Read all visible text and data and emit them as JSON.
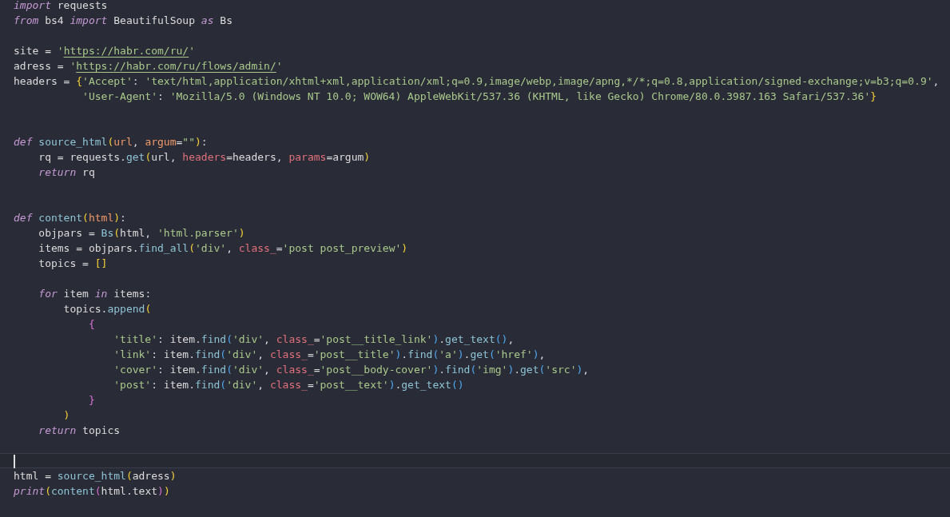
{
  "editor": {
    "lines": [
      {
        "current": false,
        "tokens": [
          {
            "kind": "keyword",
            "text": "import"
          },
          {
            "kind": "plain",
            "text": " requests"
          }
        ]
      },
      {
        "current": false,
        "tokens": [
          {
            "kind": "keyword",
            "text": "from"
          },
          {
            "kind": "plain",
            "text": " bs4 "
          },
          {
            "kind": "keyword",
            "text": "import"
          },
          {
            "kind": "plain",
            "text": " BeautifulSoup "
          },
          {
            "kind": "keyword",
            "text": "as"
          },
          {
            "kind": "plain",
            "text": " Bs"
          }
        ]
      },
      {
        "current": false
      },
      {
        "current": false,
        "tokens": [
          {
            "kind": "plain",
            "text": "site = "
          },
          {
            "kind": "string",
            "text": "'"
          },
          {
            "kind": "link",
            "text": "https://habr.com/ru/"
          },
          {
            "kind": "string",
            "text": "'"
          }
        ]
      },
      {
        "current": false,
        "tokens": [
          {
            "kind": "plain",
            "text": "adress = "
          },
          {
            "kind": "string",
            "text": "'"
          },
          {
            "kind": "link",
            "text": "https://habr.com/ru/flows/admin/"
          },
          {
            "kind": "string",
            "text": "'"
          }
        ]
      },
      {
        "current": false,
        "tokens": [
          {
            "kind": "plain",
            "text": "headers = "
          },
          {
            "kind": "bracket1",
            "text": "{"
          },
          {
            "kind": "string",
            "text": "'Accept'"
          },
          {
            "kind": "plain",
            "text": ": "
          },
          {
            "kind": "string",
            "text": "'text/html,application/xhtml+xml,application/xml;q=0.9,image/webp,image/apng,*/*;q=0.8,application/signed-exchange;v=b3;q=0.9'"
          },
          {
            "kind": "plain",
            "text": ","
          }
        ]
      },
      {
        "current": false,
        "tokens": [
          {
            "kind": "string",
            "text": "           'User-Agent'"
          },
          {
            "kind": "plain",
            "text": ": "
          },
          {
            "kind": "string",
            "text": "'Mozilla/5.0 (Windows NT 10.0; WOW64) AppleWebKit/537.36 (KHTML, like Gecko) Chrome/80.0.3987.163 Safari/537.36'"
          },
          {
            "kind": "bracket1",
            "text": "}"
          }
        ]
      },
      {
        "current": false
      },
      {
        "current": false
      },
      {
        "current": false,
        "tokens": [
          {
            "kind": "keyword",
            "text": "def "
          },
          {
            "kind": "function",
            "text": "source_html"
          },
          {
            "kind": "bracket1",
            "text": "("
          },
          {
            "kind": "param",
            "text": "url"
          },
          {
            "kind": "plain",
            "text": ", "
          },
          {
            "kind": "param",
            "text": "argum"
          },
          {
            "kind": "plain",
            "text": "="
          },
          {
            "kind": "string",
            "text": "\"\""
          },
          {
            "kind": "bracket1",
            "text": ")"
          },
          {
            "kind": "plain",
            "text": ":"
          }
        ]
      },
      {
        "current": false,
        "tokens": [
          {
            "kind": "plain",
            "text": "    rq = requests."
          },
          {
            "kind": "function",
            "text": "get"
          },
          {
            "kind": "bracket1",
            "text": "("
          },
          {
            "kind": "plain",
            "text": "url, "
          },
          {
            "kind": "kwarg",
            "text": "headers"
          },
          {
            "kind": "plain",
            "text": "=headers, "
          },
          {
            "kind": "kwarg",
            "text": "params"
          },
          {
            "kind": "plain",
            "text": "=argum"
          },
          {
            "kind": "bracket1",
            "text": ")"
          }
        ]
      },
      {
        "current": false,
        "tokens": [
          {
            "kind": "keyword",
            "text": "    return"
          },
          {
            "kind": "plain",
            "text": " rq"
          }
        ]
      },
      {
        "current": false
      },
      {
        "current": false
      },
      {
        "current": false,
        "tokens": [
          {
            "kind": "keyword",
            "text": "def "
          },
          {
            "kind": "function",
            "text": "content"
          },
          {
            "kind": "bracket1",
            "text": "("
          },
          {
            "kind": "param",
            "text": "html"
          },
          {
            "kind": "bracket1",
            "text": ")"
          },
          {
            "kind": "plain",
            "text": ":"
          }
        ]
      },
      {
        "current": false,
        "tokens": [
          {
            "kind": "plain",
            "text": "    objpars = "
          },
          {
            "kind": "function",
            "text": "Bs"
          },
          {
            "kind": "bracket1",
            "text": "("
          },
          {
            "kind": "plain",
            "text": "html, "
          },
          {
            "kind": "string",
            "text": "'html.parser'"
          },
          {
            "kind": "bracket1",
            "text": ")"
          }
        ]
      },
      {
        "current": false,
        "tokens": [
          {
            "kind": "plain",
            "text": "    items = objpars."
          },
          {
            "kind": "function",
            "text": "find_all"
          },
          {
            "kind": "bracket1",
            "text": "("
          },
          {
            "kind": "string",
            "text": "'div'"
          },
          {
            "kind": "plain",
            "text": ", "
          },
          {
            "kind": "kwarg",
            "text": "class_"
          },
          {
            "kind": "plain",
            "text": "="
          },
          {
            "kind": "string",
            "text": "'post post_preview'"
          },
          {
            "kind": "bracket1",
            "text": ")"
          }
        ]
      },
      {
        "current": false,
        "tokens": [
          {
            "kind": "plain",
            "text": "    topics = "
          },
          {
            "kind": "bracket1",
            "text": "[]"
          }
        ]
      },
      {
        "current": false
      },
      {
        "current": false,
        "tokens": [
          {
            "kind": "keyword",
            "text": "    for"
          },
          {
            "kind": "plain",
            "text": " item "
          },
          {
            "kind": "keyword",
            "text": "in"
          },
          {
            "kind": "plain",
            "text": " items:"
          }
        ]
      },
      {
        "current": false,
        "tokens": [
          {
            "kind": "plain",
            "text": "        topics."
          },
          {
            "kind": "function",
            "text": "append"
          },
          {
            "kind": "bracket1",
            "text": "("
          }
        ]
      },
      {
        "current": false,
        "tokens": [
          {
            "kind": "bracket2",
            "text": "            {"
          }
        ]
      },
      {
        "current": false,
        "tokens": [
          {
            "kind": "string",
            "text": "                'title'"
          },
          {
            "kind": "plain",
            "text": ": item."
          },
          {
            "kind": "function",
            "text": "find"
          },
          {
            "kind": "bracket3",
            "text": "("
          },
          {
            "kind": "string",
            "text": "'div'"
          },
          {
            "kind": "plain",
            "text": ", "
          },
          {
            "kind": "kwarg",
            "text": "class_"
          },
          {
            "kind": "plain",
            "text": "="
          },
          {
            "kind": "string",
            "text": "'post__title_link'"
          },
          {
            "kind": "bracket3",
            "text": ")"
          },
          {
            "kind": "plain",
            "text": "."
          },
          {
            "kind": "function",
            "text": "get_text"
          },
          {
            "kind": "bracket3",
            "text": "()"
          },
          {
            "kind": "plain",
            "text": ","
          }
        ]
      },
      {
        "current": false,
        "tokens": [
          {
            "kind": "string",
            "text": "                'link'"
          },
          {
            "kind": "plain",
            "text": ": item."
          },
          {
            "kind": "function",
            "text": "find"
          },
          {
            "kind": "bracket3",
            "text": "("
          },
          {
            "kind": "string",
            "text": "'div'"
          },
          {
            "kind": "plain",
            "text": ", "
          },
          {
            "kind": "kwarg",
            "text": "class_"
          },
          {
            "kind": "plain",
            "text": "="
          },
          {
            "kind": "string",
            "text": "'post__title'"
          },
          {
            "kind": "bracket3",
            "text": ")"
          },
          {
            "kind": "plain",
            "text": "."
          },
          {
            "kind": "function",
            "text": "find"
          },
          {
            "kind": "bracket3",
            "text": "("
          },
          {
            "kind": "string",
            "text": "'a'"
          },
          {
            "kind": "bracket3",
            "text": ")"
          },
          {
            "kind": "plain",
            "text": "."
          },
          {
            "kind": "function",
            "text": "get"
          },
          {
            "kind": "bracket3",
            "text": "("
          },
          {
            "kind": "string",
            "text": "'href'"
          },
          {
            "kind": "bracket3",
            "text": ")"
          },
          {
            "kind": "plain",
            "text": ","
          }
        ]
      },
      {
        "current": false,
        "tokens": [
          {
            "kind": "string",
            "text": "                'cover'"
          },
          {
            "kind": "plain",
            "text": ": item."
          },
          {
            "kind": "function",
            "text": "find"
          },
          {
            "kind": "bracket3",
            "text": "("
          },
          {
            "kind": "string",
            "text": "'div'"
          },
          {
            "kind": "plain",
            "text": ", "
          },
          {
            "kind": "kwarg",
            "text": "class_"
          },
          {
            "kind": "plain",
            "text": "="
          },
          {
            "kind": "string",
            "text": "'post__body-cover'"
          },
          {
            "kind": "bracket3",
            "text": ")"
          },
          {
            "kind": "plain",
            "text": "."
          },
          {
            "kind": "function",
            "text": "find"
          },
          {
            "kind": "bracket3",
            "text": "("
          },
          {
            "kind": "string",
            "text": "'img'"
          },
          {
            "kind": "bracket3",
            "text": ")"
          },
          {
            "kind": "plain",
            "text": "."
          },
          {
            "kind": "function",
            "text": "get"
          },
          {
            "kind": "bracket3",
            "text": "("
          },
          {
            "kind": "string",
            "text": "'src'"
          },
          {
            "kind": "bracket3",
            "text": ")"
          },
          {
            "kind": "plain",
            "text": ","
          }
        ]
      },
      {
        "current": false,
        "tokens": [
          {
            "kind": "string",
            "text": "                'post'"
          },
          {
            "kind": "plain",
            "text": ": item."
          },
          {
            "kind": "function",
            "text": "find"
          },
          {
            "kind": "bracket3",
            "text": "("
          },
          {
            "kind": "string",
            "text": "'div'"
          },
          {
            "kind": "plain",
            "text": ", "
          },
          {
            "kind": "kwarg",
            "text": "class_"
          },
          {
            "kind": "plain",
            "text": "="
          },
          {
            "kind": "string",
            "text": "'post__text'"
          },
          {
            "kind": "bracket3",
            "text": ")"
          },
          {
            "kind": "plain",
            "text": "."
          },
          {
            "kind": "function",
            "text": "get_text"
          },
          {
            "kind": "bracket3",
            "text": "()"
          }
        ]
      },
      {
        "current": false,
        "tokens": [
          {
            "kind": "bracket2",
            "text": "            }"
          }
        ]
      },
      {
        "current": false,
        "tokens": [
          {
            "kind": "bracket1",
            "text": "        )"
          }
        ]
      },
      {
        "current": false,
        "tokens": [
          {
            "kind": "keyword",
            "text": "    return"
          },
          {
            "kind": "plain",
            "text": " topics"
          }
        ]
      },
      {
        "current": false
      },
      {
        "current": true
      },
      {
        "current": false,
        "tokens": [
          {
            "kind": "plain",
            "text": "html = "
          },
          {
            "kind": "function",
            "text": "source_html"
          },
          {
            "kind": "bracket1",
            "text": "("
          },
          {
            "kind": "plain",
            "text": "adress"
          },
          {
            "kind": "bracket1",
            "text": ")"
          }
        ]
      },
      {
        "current": false,
        "tokens": [
          {
            "kind": "builtin",
            "text": "print"
          },
          {
            "kind": "bracket1",
            "text": "("
          },
          {
            "kind": "function",
            "text": "content"
          },
          {
            "kind": "bracket2",
            "text": "("
          },
          {
            "kind": "plain",
            "text": "html.text"
          },
          {
            "kind": "bracket2",
            "text": ")"
          },
          {
            "kind": "bracket1",
            "text": ")"
          }
        ]
      }
    ]
  }
}
